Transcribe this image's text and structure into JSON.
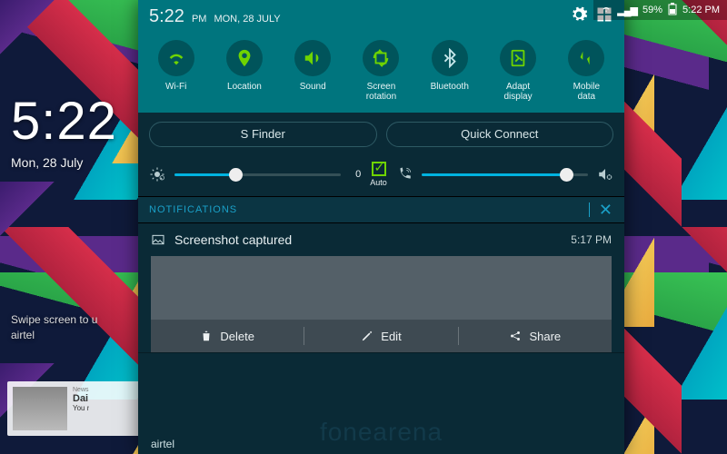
{
  "system": {
    "battery": "59%",
    "time": "5:22 PM",
    "signal": "▂▄▆"
  },
  "lock": {
    "time": "5:22",
    "date": "Mon, 28 July",
    "swipe": "Swipe screen to u",
    "carrier": "airtel",
    "mag_headline": "Dai",
    "mag_sub": "You r"
  },
  "panel": {
    "time": "5:22",
    "ampm": "PM",
    "date": "MON, 28 JULY",
    "toggles": [
      {
        "label": "Wi-Fi",
        "on": true
      },
      {
        "label": "Location",
        "on": true
      },
      {
        "label": "Sound",
        "on": true
      },
      {
        "label": "Screen\nrotation",
        "on": true
      },
      {
        "label": "Bluetooth",
        "on": false
      },
      {
        "label": "Adapt\ndisplay",
        "on": true
      },
      {
        "label": "Mobile\ndata",
        "on": true
      }
    ],
    "sfinder": "S Finder",
    "quickconnect": "Quick Connect",
    "brightness": {
      "value": 0,
      "pct": 35,
      "auto_label": "Auto"
    },
    "volume": {
      "pct": 85
    },
    "notif_header": "NOTIFICATIONS",
    "notif": {
      "title": "Screenshot captured",
      "time": "5:17 PM",
      "actions": {
        "delete": "Delete",
        "edit": "Edit",
        "share": "Share"
      }
    },
    "carrier": "airtel",
    "watermark": "fonearena"
  }
}
